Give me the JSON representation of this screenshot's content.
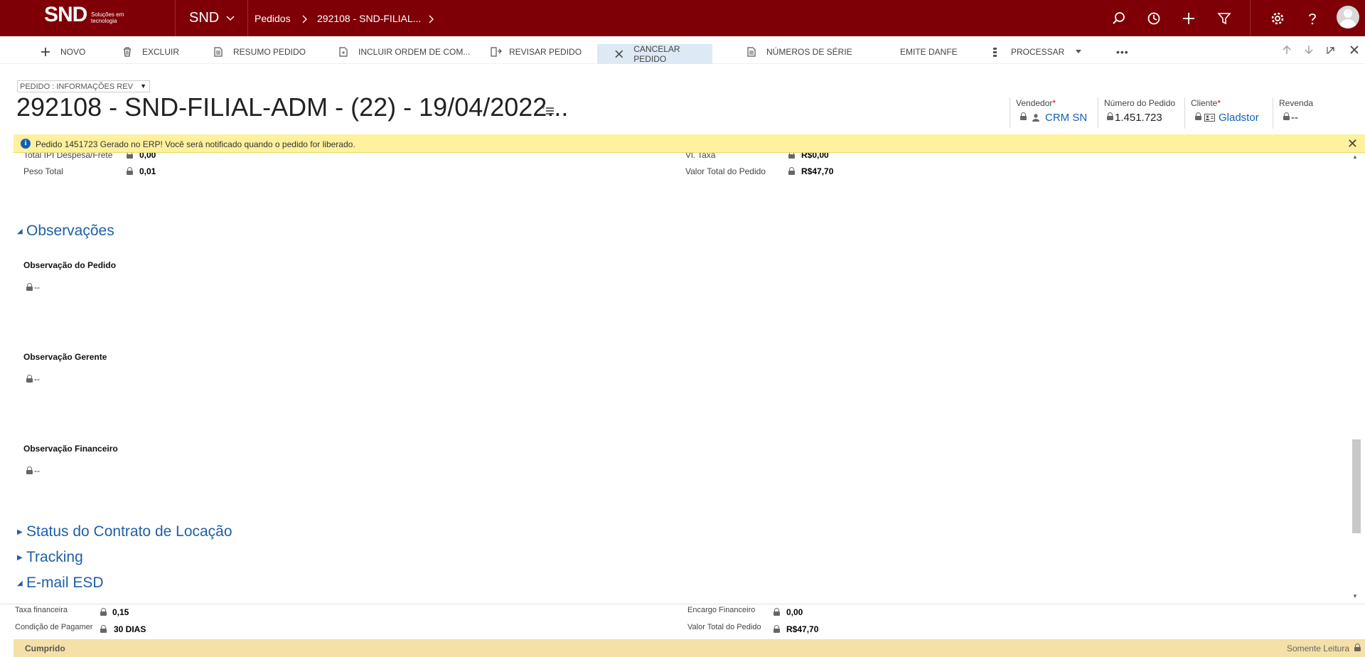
{
  "topnav": {
    "logo_text": "SND",
    "logo_sub": "Soluções em tecnologia",
    "app_name": "SND",
    "breadcrumb": [
      "Pedidos",
      "292108 - SND-FILIAL..."
    ],
    "icons": [
      "search-icon",
      "history-icon",
      "plus-icon",
      "filter-icon",
      "gear-icon",
      "help-icon",
      "user-avatar"
    ]
  },
  "commandbar": {
    "items": [
      {
        "label": "NOVO",
        "icon": "plus-icon"
      },
      {
        "label": "EXCLUIR",
        "icon": "trash-icon"
      },
      {
        "label": "RESUMO PEDIDO",
        "icon": "document-icon"
      },
      {
        "label": "INCLUIR ORDEM DE COM...",
        "icon": "document-add-icon"
      },
      {
        "label": "REVISAR PEDIDO",
        "icon": "review-icon"
      },
      {
        "label": "CANCELAR PEDIDO",
        "icon": "close-icon"
      },
      {
        "label": "NÚMEROS DE SÉRIE",
        "icon": "document-icon"
      },
      {
        "label": "EMITE DANFE",
        "icon": ""
      },
      {
        "label": "PROCESSAR",
        "icon": "process-icon"
      }
    ],
    "more": "•••"
  },
  "header": {
    "form_selector": "PEDIDO : INFORMAÇÕES REV",
    "title": "292108 - SND-FILIAL-ADM - (22) - 19/04/2022...",
    "fields": [
      {
        "label": "Vendedor",
        "required": "*",
        "value": "CRM SN"
      },
      {
        "label": "Número do Pedido",
        "required": "",
        "value": "1.451.723"
      },
      {
        "label": "Cliente",
        "required": "*",
        "value": "Gladstor"
      },
      {
        "label": "Revenda",
        "required": "",
        "value": "--"
      }
    ]
  },
  "notification": {
    "text": "Pedido 1451723 Gerado no ERP! Você será notificado quando o pedido for liberado.",
    "close": "✕"
  },
  "content": {
    "top_rows": [
      {
        "label": "Total IPI Despesa/Frete",
        "value": "0,00",
        "label_r": "Vl. Taxa",
        "value_r": "R$0,00"
      },
      {
        "label": "Peso Total",
        "value": "0,01",
        "label_r": "Valor Total do Pedido",
        "value_r": "R$47,70"
      }
    ],
    "sections": {
      "observacoes": "Observações",
      "status_contrato": "Status do Contrato de Locação",
      "tracking": "Tracking",
      "email_esd": "E-mail ESD"
    },
    "observations": [
      {
        "label": "Observação do Pedido",
        "value": "--"
      },
      {
        "label": "Observação Gerente",
        "value": "--"
      },
      {
        "label": "Observação Financeiro",
        "value": "--"
      }
    ]
  },
  "footer": {
    "rows": [
      {
        "label": "Taxa financeira",
        "value": "0,15",
        "label_r": "Encargo Financeiro",
        "value_r": "0,00"
      },
      {
        "label": "Condição de Pagamer",
        "value": "30 DIAS",
        "label_r": "Valor Total do Pedido",
        "value_r": "R$47,70"
      }
    ],
    "status_left": "Cumprido",
    "status_right": "Somente Leitura"
  }
}
